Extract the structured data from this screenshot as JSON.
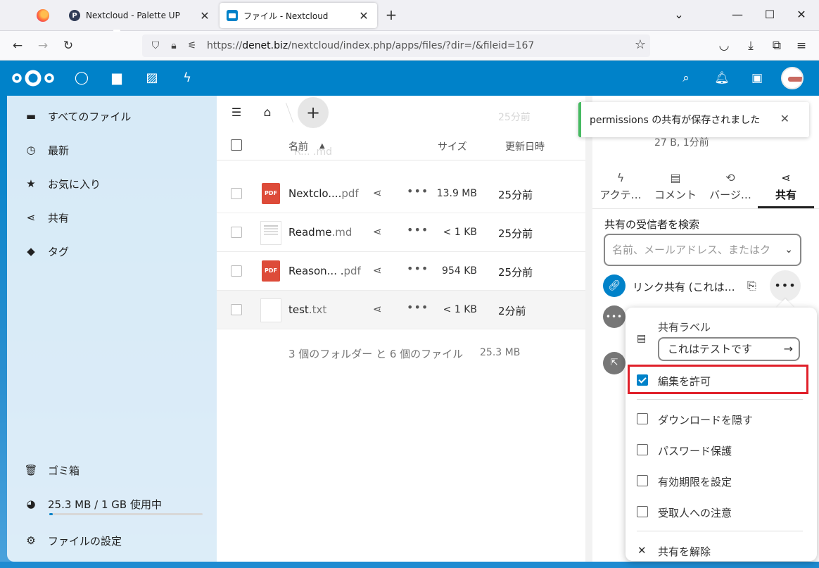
{
  "browser": {
    "tabs": [
      {
        "title": "Nextcloud - Palette UP",
        "favicon": "P"
      },
      {
        "title": "ファイル - Nextcloud"
      }
    ],
    "url": {
      "prefix": "https://",
      "host": "denet.biz",
      "path": "/nextcloud/index.php/apps/files/?dir=/&fileid=167"
    }
  },
  "nav": {
    "items": [
      {
        "label": "すべてのファイル",
        "icon": "folder-icon"
      },
      {
        "label": "最新",
        "icon": "clock-icon"
      },
      {
        "label": "お気に入り",
        "icon": "star-icon"
      },
      {
        "label": "共有",
        "icon": "share-icon"
      },
      {
        "label": "タグ",
        "icon": "tag-icon"
      }
    ],
    "trash": "ゴミ箱",
    "quota": "25.3 MB / 1 GB 使用中",
    "quota_fraction": 0.025,
    "settings": "ファイルの設定"
  },
  "files": {
    "header": {
      "name": "名前",
      "size": "サイズ",
      "modified": "更新日時"
    },
    "faded_rows": [
      {
        "modified": "25分前"
      },
      {
        "name": "R... .md"
      }
    ],
    "rows": [
      {
        "name": "Nextclo....",
        "ext": "pdf",
        "type": "pdf",
        "size": "13.9 MB",
        "modified": "25分前"
      },
      {
        "name": "Readme",
        "ext": ".md",
        "type": "md",
        "size": "< 1 KB",
        "modified": "25分前"
      },
      {
        "name": "Reason... .",
        "ext": "pdf",
        "type": "pdf",
        "size": "954 KB",
        "modified": "25分前"
      },
      {
        "name": "test",
        "ext": ".txt",
        "type": "txt",
        "size": "< 1 KB",
        "modified": "2分前"
      }
    ],
    "summary": "3 個のフォルダー と 6 個のファイル",
    "summary_size": "25.3 MB"
  },
  "sidebar": {
    "subtitle": "27 B, 1分前",
    "tabs": [
      {
        "label": "アクテ…",
        "icon": "activity-icon"
      },
      {
        "label": "コメント",
        "icon": "comment-icon"
      },
      {
        "label": "バージ…",
        "icon": "history-icon"
      },
      {
        "label": "共有",
        "icon": "share-icon"
      }
    ],
    "search_label": "共有の受信者を検索",
    "search_placeholder": "名前、メールアドレス、またはク",
    "link_share": "リンク共有 (これは…"
  },
  "toast": {
    "text": "permissions の共有が保存されました"
  },
  "menu": {
    "label_title": "共有ラベル",
    "label_value": "これはテストです",
    "items": [
      {
        "label": "編集を許可",
        "checked": true
      },
      {
        "label": "ダウンロードを隠す",
        "checked": false
      },
      {
        "label": "パスワード保護",
        "checked": false
      },
      {
        "label": "有効期限を設定",
        "checked": false
      },
      {
        "label": "受取人への注意",
        "checked": false
      }
    ],
    "unshare": "共有を解除"
  },
  "colors": {
    "brand": "#0082c9",
    "highlight": "#e0202a",
    "toast_accent": "#46ba61",
    "pdf": "#dd4b39"
  }
}
